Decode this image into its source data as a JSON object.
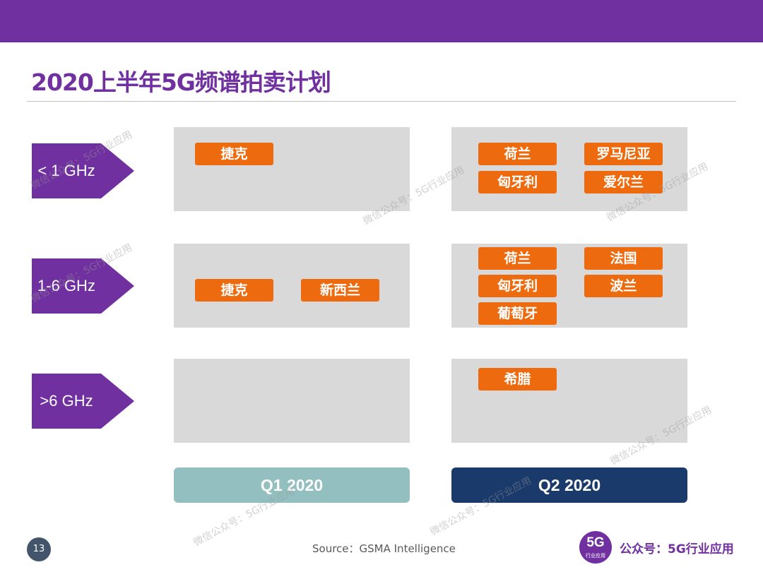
{
  "title": "2020上半年5G频谱拍卖计划",
  "bands": [
    "< 1 GHz",
    "1-6 GHz",
    ">6 GHz"
  ],
  "quarters": [
    {
      "label": "Q1 2020",
      "color": "#93bfc0"
    },
    {
      "label": "Q2 2020",
      "color": "#1a3a6b"
    }
  ],
  "grid": {
    "lt1_q1": [
      "捷克"
    ],
    "lt1_q2": [
      "荷兰",
      "罗马尼亚",
      "匈牙利",
      "爱尔兰"
    ],
    "mid_q1": [
      "捷克",
      "新西兰"
    ],
    "mid_q2": [
      "荷兰",
      "法国",
      "匈牙利",
      "波兰",
      "葡萄牙"
    ],
    "gt6_q1": [],
    "gt6_q2": [
      "希腊"
    ]
  },
  "watermark": "微信公众号：5G行业应用",
  "footer": {
    "page_number": "13",
    "source": "Source：GSMA Intelligence",
    "logo_big": "5G",
    "logo_small": "行业应用",
    "brand": "公众号：5G行业应用"
  },
  "colors": {
    "accent": "#7030a0",
    "pill": "#ed6b0e",
    "cell": "#d9d9d9"
  }
}
